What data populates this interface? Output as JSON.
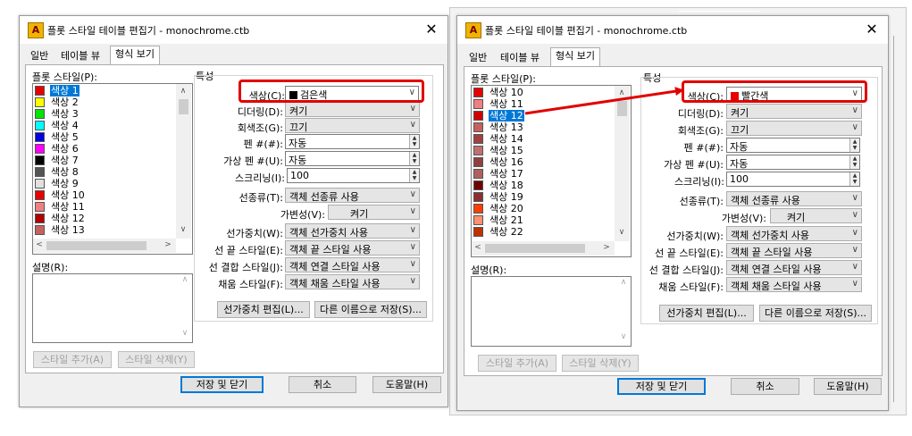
{
  "left": {
    "title": "플롯 스타일 테이블 편집기 - monochrome.ctb",
    "close": "✕",
    "tabs": [
      "일반",
      "테이블 뷰",
      "형식 보기"
    ],
    "plot_styles_label": "플롯 스타일(P):",
    "styles": [
      {
        "name": "색상 1",
        "color": "#e60000",
        "selected": true
      },
      {
        "name": "색상 2",
        "color": "#ffff00"
      },
      {
        "name": "색상 3",
        "color": "#00e600"
      },
      {
        "name": "색상 4",
        "color": "#00ffff"
      },
      {
        "name": "색상 5",
        "color": "#0000e0"
      },
      {
        "name": "색상 6",
        "color": "#ff00ff"
      },
      {
        "name": "색상 7",
        "color": "#000000"
      },
      {
        "name": "색상 8",
        "color": "#555555"
      },
      {
        "name": "색상 9",
        "color": "#e0e0e0"
      },
      {
        "name": "색상 10",
        "color": "#e60000"
      },
      {
        "name": "색상 11",
        "color": "#f08080"
      },
      {
        "name": "색상 12",
        "color": "#b00000"
      },
      {
        "name": "색상 13",
        "color": "#c86060"
      }
    ],
    "desc_label": "설명(R):",
    "add_style": "스타일 추가(A)",
    "delete_style": "스타일 삭제(Y)",
    "properties_label": "특성",
    "color_label": "색상(C):",
    "color_value": "검은색",
    "color_swatch": "#000000",
    "dither_label": "디더링(D):",
    "dither_value": "켜기",
    "grayscale_label": "회색조(G):",
    "grayscale_value": "끄기",
    "pen_label": "펜 #(#):",
    "pen_value": "자동",
    "vpen_label": "가상 펜 #(U):",
    "vpen_value": "자동",
    "screening_label": "스크리닝(I):",
    "screening_value": "100",
    "linetype_label": "선종류(T):",
    "linetype_value": "객체 선종류 사용",
    "adaptive_label": "가변성(V):",
    "adaptive_value": "켜기",
    "lineweight_label": "선가중치(W):",
    "lineweight_value": "객체 선가중치 사용",
    "endstyle_label": "선 끝 스타일(E):",
    "endstyle_value": "객체 끝 스타일 사용",
    "joinstyle_label": "선 결합 스타일(J):",
    "joinstyle_value": "객체 연결 스타일 사용",
    "fillstyle_label": "채움 스타일(F):",
    "fillstyle_value": "객체 채움 스타일 사용",
    "edit_lineweights": "선가중치 편집(L)...",
    "save_as": "다른 이름으로 저장(S)...",
    "save_close": "저장 및 닫기",
    "cancel": "취소",
    "help": "도움말(H)"
  },
  "right": {
    "title": "플롯 스타일 테이블 편집기 - monochrome.ctb",
    "close": "✕",
    "tabs": [
      "일반",
      "테이블 뷰",
      "형식 보기"
    ],
    "plot_styles_label": "플롯 스타일(P):",
    "styles": [
      {
        "name": "색상 10",
        "color": "#e60000"
      },
      {
        "name": "색상 11",
        "color": "#f08080"
      },
      {
        "name": "색상 12",
        "color": "#d00000",
        "selected": true
      },
      {
        "name": "색상 13",
        "color": "#c86060"
      },
      {
        "name": "색상 14",
        "color": "#a04040"
      },
      {
        "name": "색상 15",
        "color": "#c07070"
      },
      {
        "name": "색상 16",
        "color": "#904040"
      },
      {
        "name": "색상 17",
        "color": "#b06060"
      },
      {
        "name": "색상 18",
        "color": "#700000"
      },
      {
        "name": "색상 19",
        "color": "#8a3030"
      },
      {
        "name": "색상 20",
        "color": "#ff4000"
      },
      {
        "name": "색상 21",
        "color": "#ff9070"
      },
      {
        "name": "색상 22",
        "color": "#c03000"
      }
    ],
    "desc_label": "설명(R):",
    "add_style": "스타일 추가(A)",
    "delete_style": "스타일 삭제(Y)",
    "properties_label": "특성",
    "color_label": "색상(C):",
    "color_value": "빨간색",
    "color_swatch": "#e60000",
    "dither_label": "디더링(D):",
    "dither_value": "켜기",
    "grayscale_label": "회색조(G):",
    "grayscale_value": "끄기",
    "pen_label": "펜 #(#):",
    "pen_value": "자동",
    "vpen_label": "가상 펜 #(U):",
    "vpen_value": "자동",
    "screening_label": "스크리닝(I):",
    "screening_value": "100",
    "linetype_label": "선종류(T):",
    "linetype_value": "객체 선종류 사용",
    "adaptive_label": "가변성(V):",
    "adaptive_value": "켜기",
    "lineweight_label": "선가중치(W):",
    "lineweight_value": "객체 선가중치 사용",
    "endstyle_label": "선 끝 스타일(E):",
    "endstyle_value": "객체 끝 스타일 사용",
    "joinstyle_label": "선 결합 스타일(J):",
    "joinstyle_value": "객체 연결 스타일 사용",
    "fillstyle_label": "채움 스타일(F):",
    "fillstyle_value": "객체 채움 스타일 사용",
    "edit_lineweights": "선가중치 편집(L)...",
    "save_as": "다른 이름으로 저장(S)...",
    "save_close": "저장 및 닫기",
    "cancel": "취소",
    "help": "도움말(H)"
  },
  "annotation_color": "#e10000"
}
